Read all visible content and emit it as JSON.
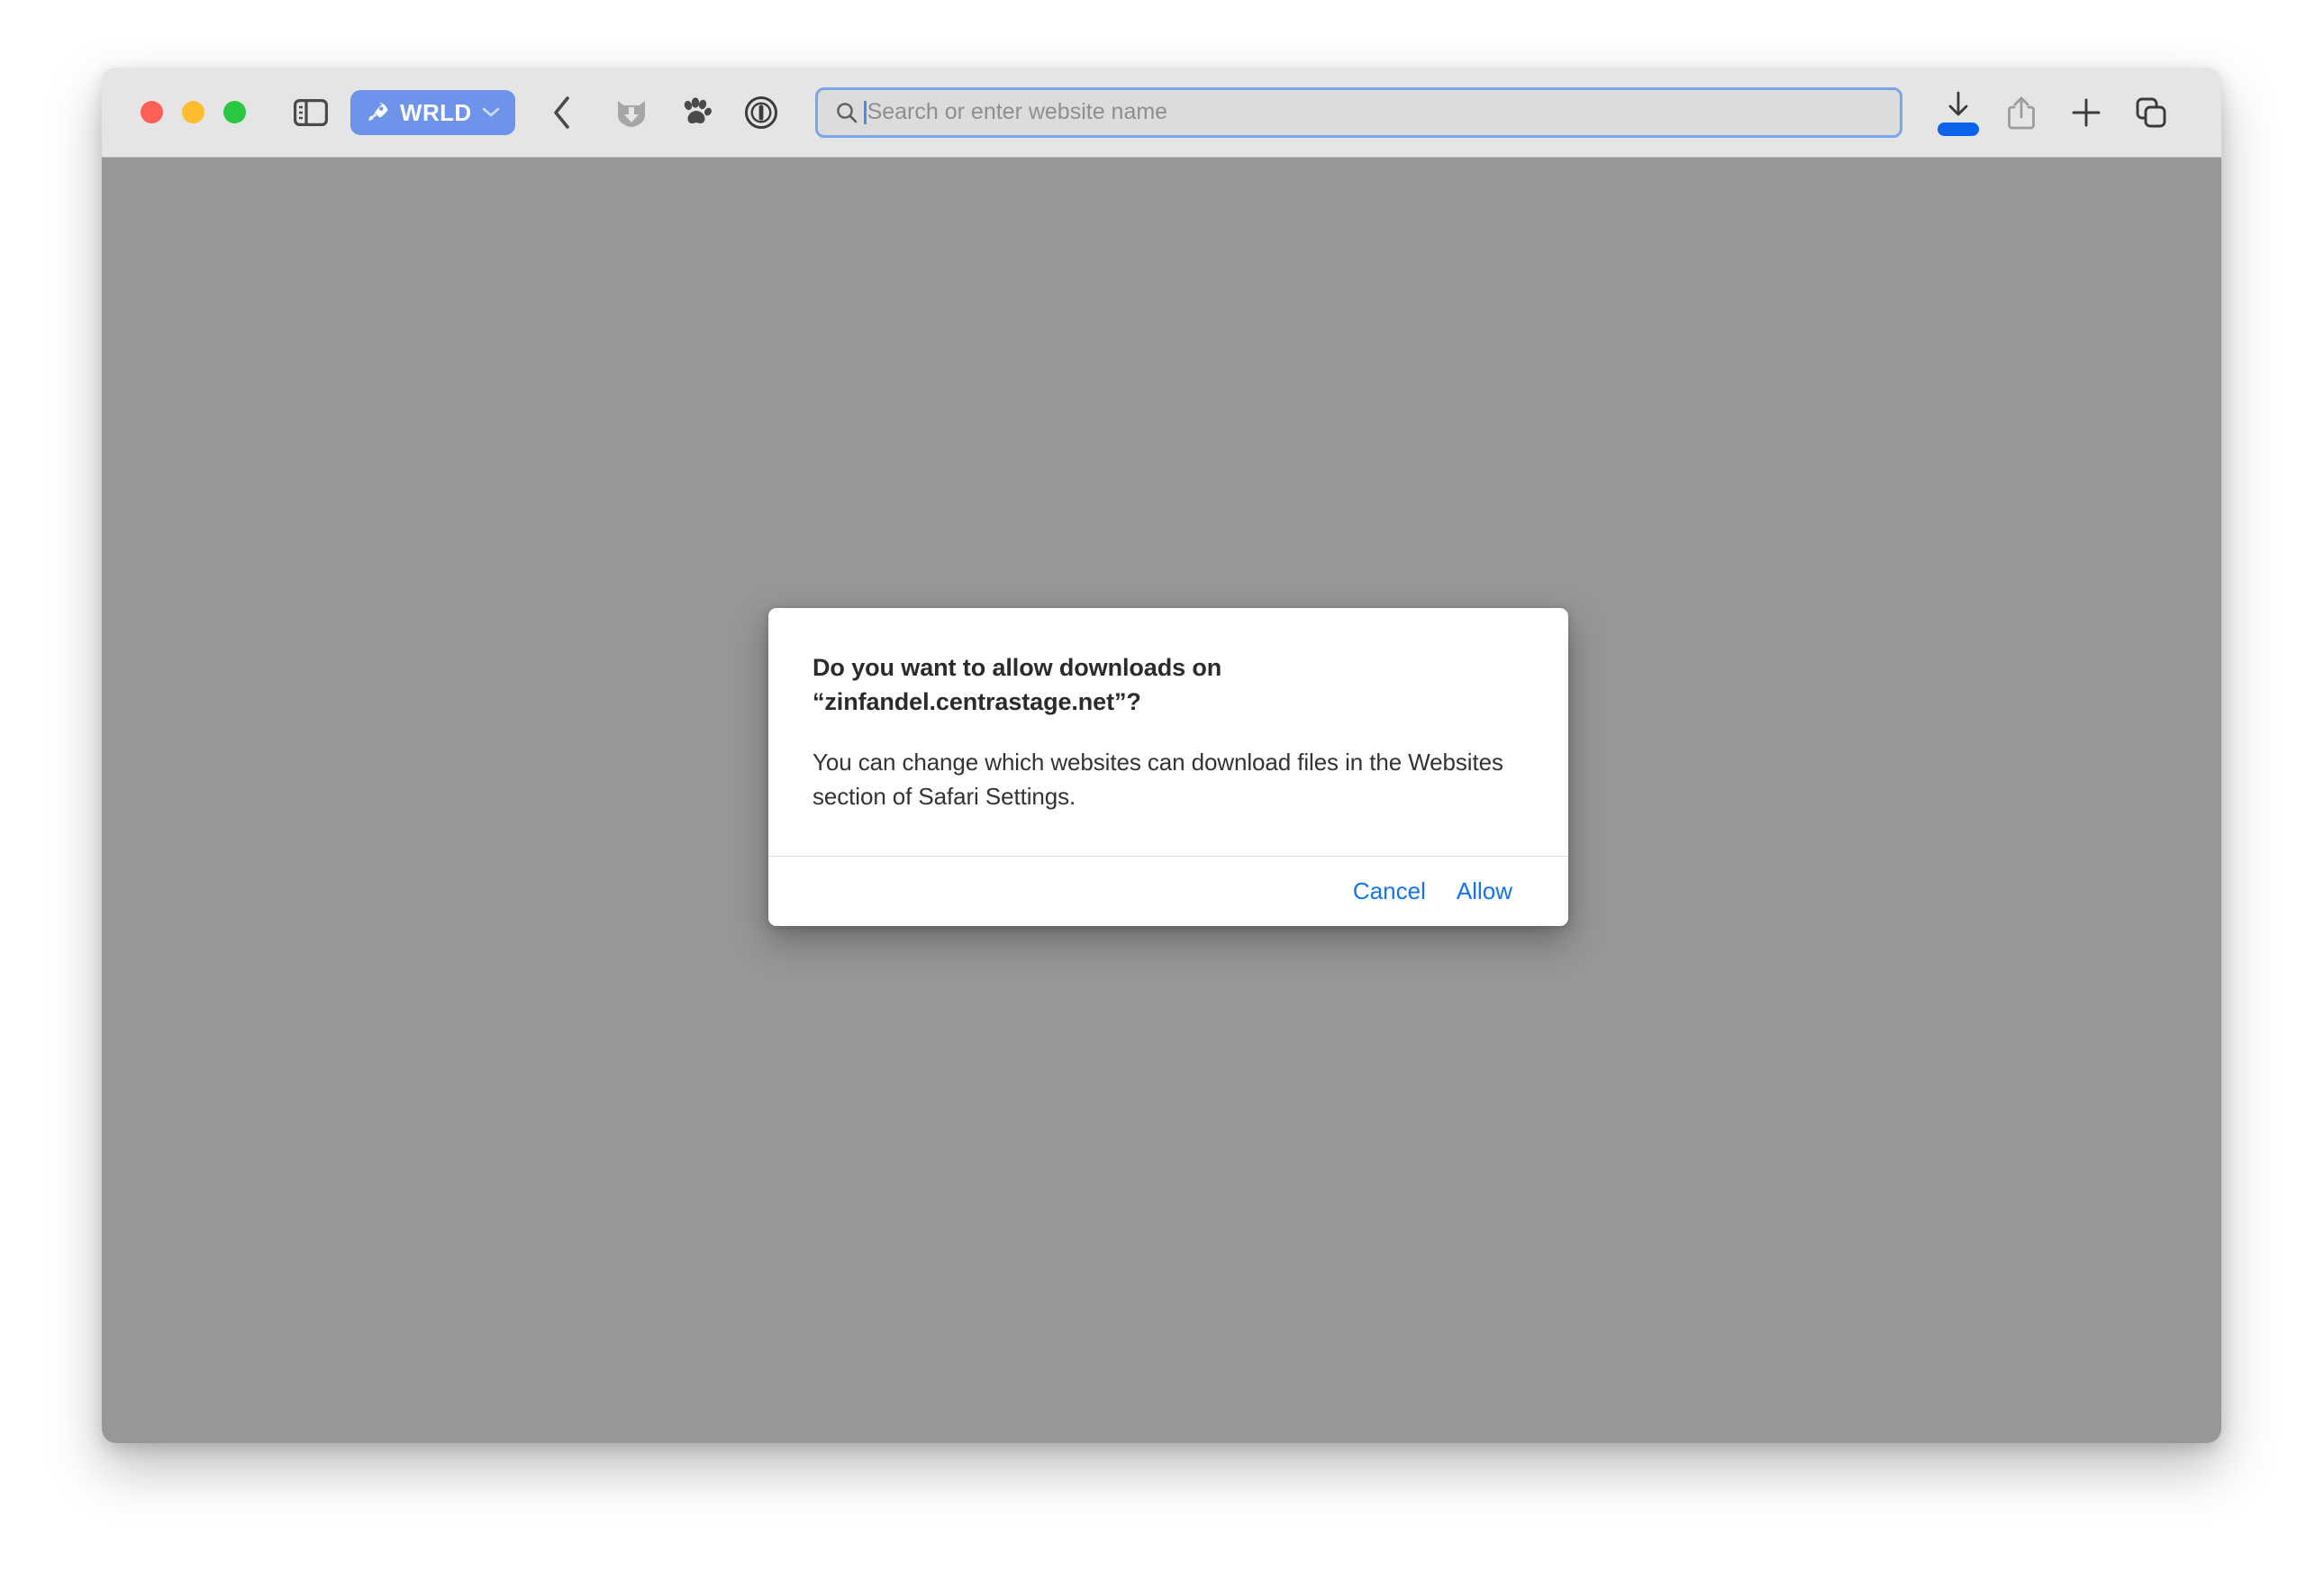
{
  "window": {
    "traffic_lights": [
      {
        "name": "close",
        "color": "#ff5f57",
        "label": "Close"
      },
      {
        "name": "minimize",
        "color": "#febc2e",
        "label": "Minimize"
      },
      {
        "name": "maximize",
        "color": "#28c840",
        "label": "Maximize"
      }
    ]
  },
  "toolbar": {
    "sidebar_toggle_icon": "sidebar-icon",
    "profile": {
      "icon": "rocket-icon",
      "label": "WRLD",
      "chevron_icon": "chevron-down-icon",
      "color": "#6d93ea"
    },
    "back_icon": "chevron-left-icon",
    "extensions": [
      {
        "name": "cat-shield-download-extension",
        "icon": "cat-shield-download-icon",
        "color": "#a6a6a6"
      },
      {
        "name": "paw-extension",
        "icon": "paw-print-icon",
        "color": "#4a4a4a"
      },
      {
        "name": "onepassword-extension",
        "icon": "onepassword-keyhole-icon",
        "color": "#3d3d3d"
      }
    ],
    "address_bar": {
      "search_icon": "search-icon",
      "value": "",
      "placeholder": "Search or enter website name",
      "focused": true,
      "focus_ring_color": "#7aa7e8",
      "caret_color": "#4a8bf0"
    },
    "right_actions": [
      {
        "name": "downloads-button",
        "icon": "download-arrow-icon",
        "has_progress": true,
        "progress_color": "#0a63e8"
      },
      {
        "name": "share-button",
        "icon": "share-icon",
        "has_progress": false
      },
      {
        "name": "new-tab-button",
        "icon": "plus-icon",
        "has_progress": false
      },
      {
        "name": "tab-overview-button",
        "icon": "copy-tabs-icon",
        "has_progress": false
      }
    ]
  },
  "content": {
    "background_color": "#979797"
  },
  "dialog": {
    "title": "Do you want to allow downloads on “zinfandel.centrastage.net”?",
    "message": "You can change which websites can download files in the Websites section of Safari Settings.",
    "cancel_label": "Cancel",
    "allow_label": "Allow",
    "action_color": "#1274ef"
  }
}
